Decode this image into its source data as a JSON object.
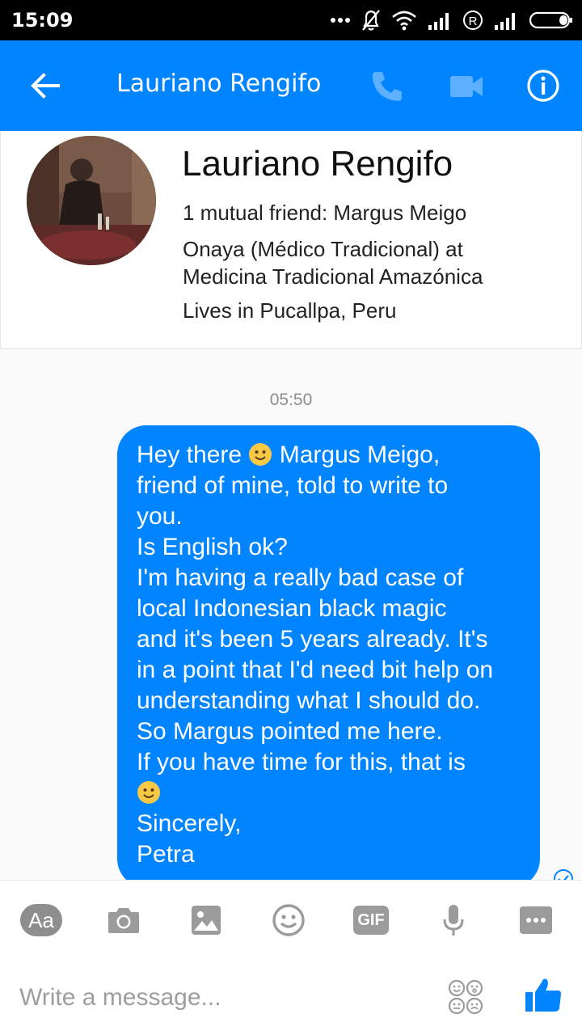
{
  "status_bar": {
    "time": "15:09",
    "icons": [
      "dots-icon",
      "mute-bell-icon",
      "wifi-icon",
      "signal-icon",
      "roaming-r-icon",
      "signal-icon",
      "battery-icon"
    ]
  },
  "header": {
    "title": "Lauriano Rengifo",
    "icons": [
      "back-arrow-icon",
      "phone-icon",
      "video-camera-icon",
      "info-icon"
    ],
    "colors": {
      "bar": "#0084ff",
      "phone_video_disabled": "#5cb0ff"
    }
  },
  "profile": {
    "name": "Lauriano Rengifo",
    "mutual": "1 mutual friend: Margus Meigo",
    "work_line1": "Onaya (Médico Tradicional) at",
    "work_line2": "Medicina Tradicional Amazónica",
    "location": "Lives in Pucallpa, Peru"
  },
  "conversation": {
    "timestamp": "05:50",
    "message": {
      "lines": [
        "Hey there ",
        " Margus Meigo,",
        "friend of mine,  told to write to",
        "you.",
        "Is English ok?",
        "I'm having a really bad case of",
        "local Indonesian black magic",
        "and it's been 5 years already.  It's",
        "in a point that I'd need bit help on",
        "understanding what I should do.",
        "So Margus pointed me here.",
        "If you have time for this,  that is",
        "Sincerely,",
        "Petra"
      ],
      "bubble_color": "#0084ff"
    }
  },
  "composer": {
    "placeholder": "Write a message...",
    "aa_label": "Aa",
    "gif_label": "GIF",
    "icons": [
      "text-style-icon",
      "camera-icon",
      "image-icon",
      "emoji-icon",
      "gif-icon",
      "microphone-icon",
      "more-icon",
      "stickers-icon",
      "thumbs-up-icon"
    ]
  }
}
